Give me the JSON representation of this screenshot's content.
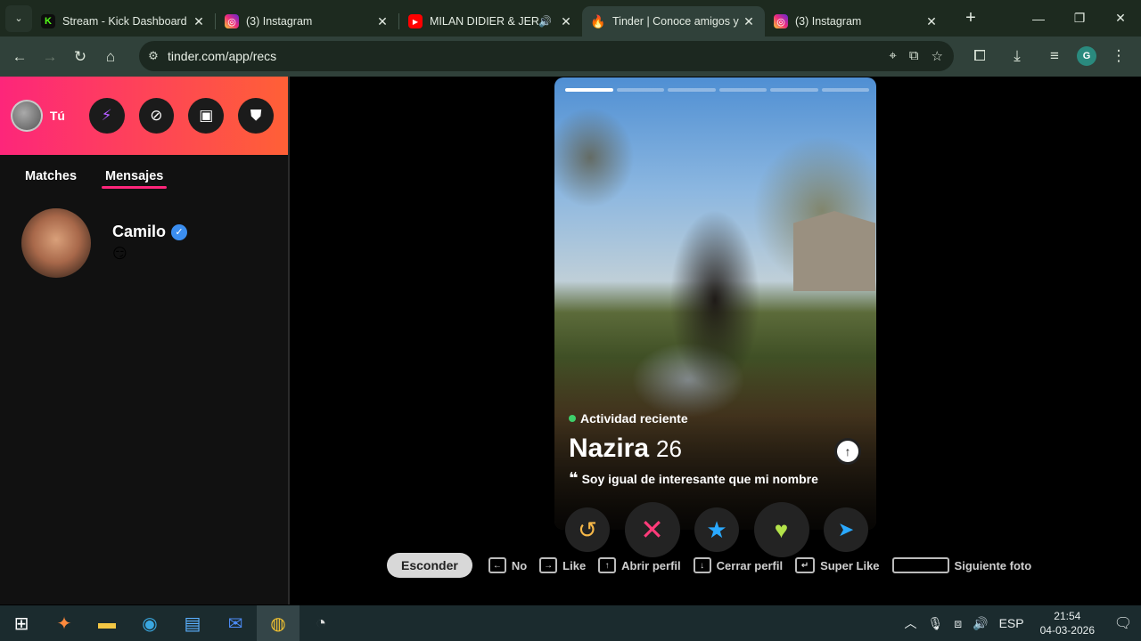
{
  "browser": {
    "tabs": [
      {
        "title": "Stream - Kick Dashboard",
        "favicon": "kick-icon",
        "color": "#53fc18",
        "glyph": "K"
      },
      {
        "title": "(3) Instagram",
        "favicon": "instagram-icon",
        "color": "#e1306c",
        "glyph": "◎"
      },
      {
        "title": "MILAN DIDIER & JER",
        "favicon": "youtube-icon",
        "color": "#ff0000",
        "glyph": "▶"
      },
      {
        "title": "Tinder | Conoce amigos y",
        "favicon": "tinder-icon",
        "color": "#fd5068",
        "glyph": "♦"
      },
      {
        "title": "(3) Instagram",
        "favicon": "instagram-icon",
        "color": "#e1306c",
        "glyph": "◎"
      }
    ],
    "url": "tinder.com/app/recs",
    "profile_initial": "G"
  },
  "sidebar": {
    "me_label": "Tú",
    "tabs": [
      "Matches",
      "Mensajes"
    ],
    "match": {
      "name": "Camilo",
      "message": "😏"
    }
  },
  "profile": {
    "activity": "Actividad reciente",
    "name": "Nazira",
    "age": "26",
    "bio": "Soy igual de interesante que mi nombre",
    "photo_count": 6,
    "photo_index": 1
  },
  "hints": {
    "hide": "Esconder",
    "no": "No",
    "like": "Like",
    "open": "Abrir perfil",
    "close": "Cerrar perfil",
    "super": "Super Like",
    "next": "Siguiente foto"
  },
  "taskbar": {
    "lang": "ESP",
    "time": "21:54",
    "date": "04-03-2026"
  }
}
